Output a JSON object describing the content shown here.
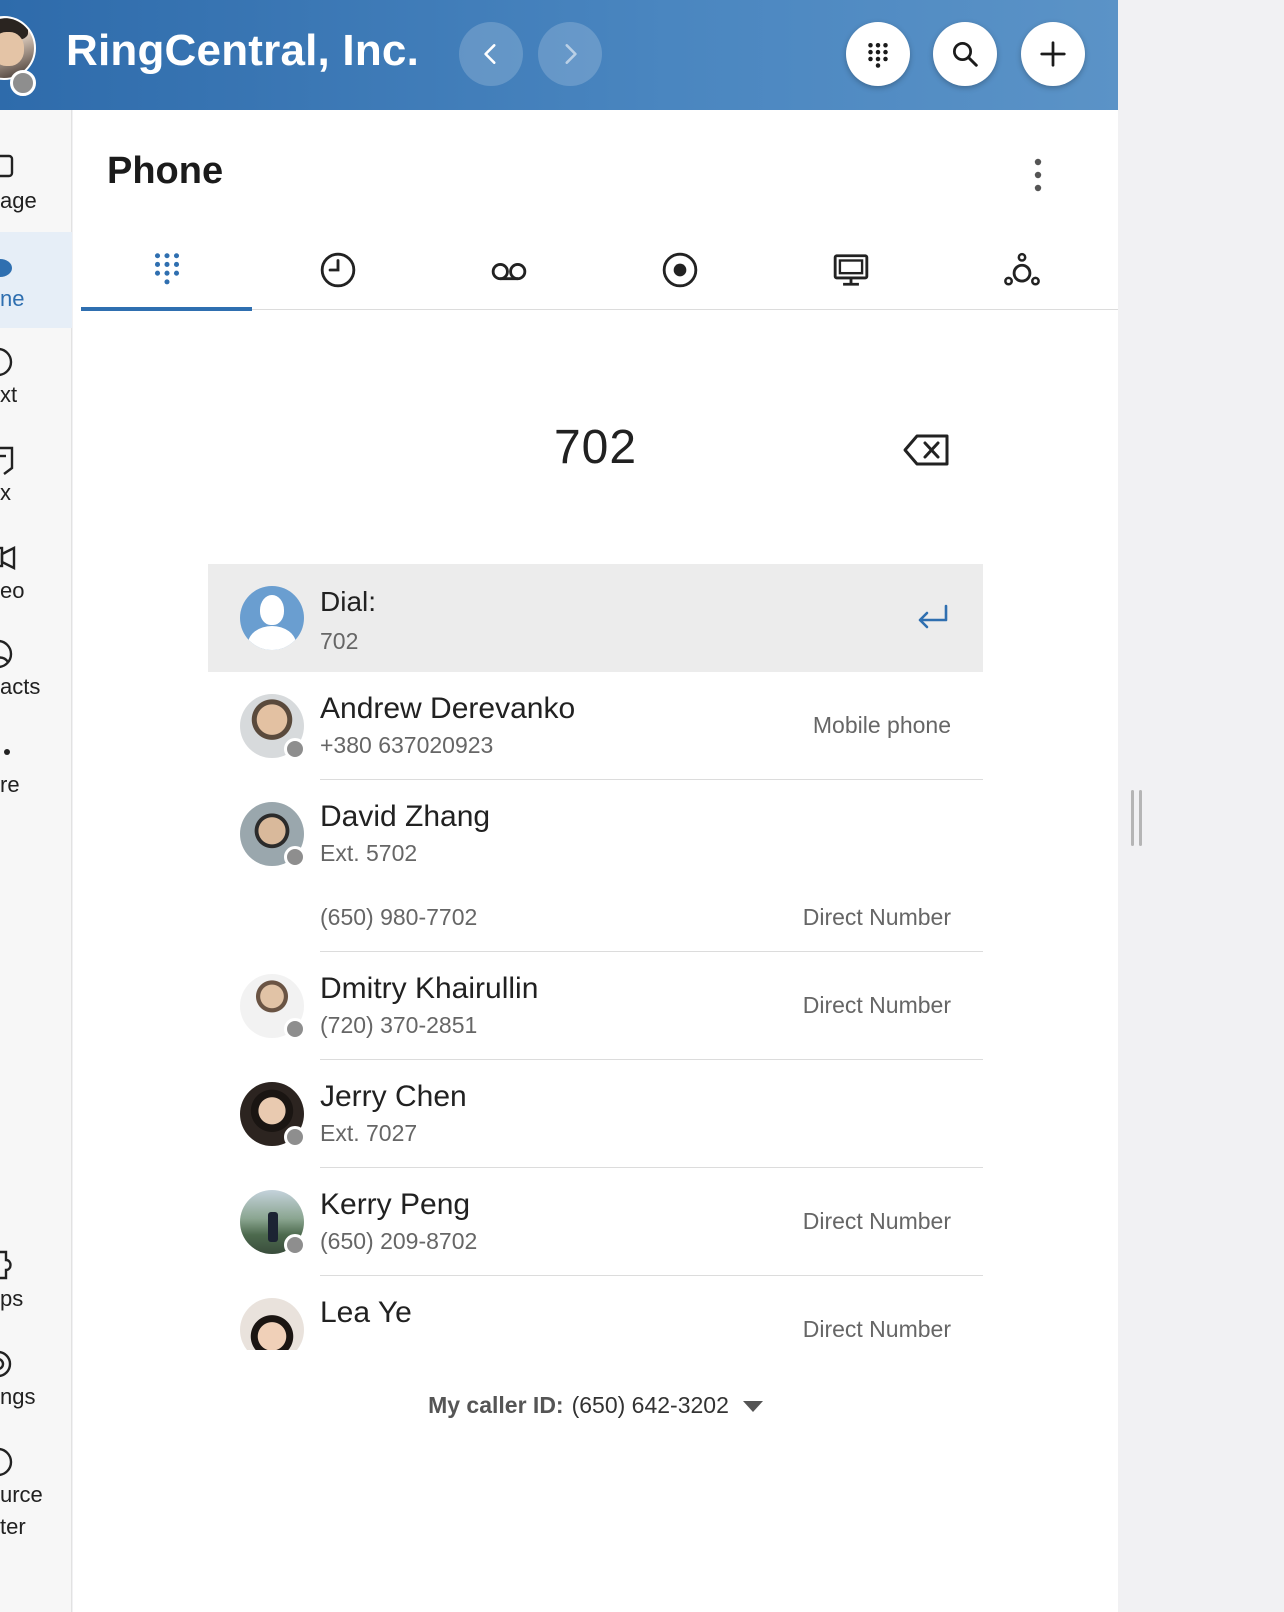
{
  "header": {
    "company": "RingCentral, Inc.",
    "icons": {
      "back": "chevron-left-icon",
      "forward": "chevron-right-icon",
      "dialpad": "dialpad-icon",
      "search": "search-icon",
      "add": "plus-icon"
    },
    "accent": "#2f6fb0"
  },
  "leftnav": {
    "items": [
      {
        "label": "age",
        "icon": "message-icon"
      },
      {
        "label": "ne",
        "icon": "phone-icon",
        "active": true
      },
      {
        "label": "xt",
        "icon": "text-icon"
      },
      {
        "label": "x",
        "icon": "fax-icon"
      },
      {
        "label": "eo",
        "icon": "video-icon"
      },
      {
        "label": "acts",
        "icon": "contacts-icon"
      },
      {
        "label": "re",
        "icon": "more-icon"
      },
      {
        "label": "ps",
        "icon": "apps-icon"
      },
      {
        "label": "ngs",
        "icon": "settings-icon"
      },
      {
        "label": "urce",
        "label2": "ter",
        "icon": "resource-center-icon"
      }
    ]
  },
  "main": {
    "title": "Phone",
    "tabs": [
      {
        "name": "dialpad",
        "icon": "dialpad-icon",
        "active": true
      },
      {
        "name": "call-history",
        "icon": "clock-icon"
      },
      {
        "name": "voicemail",
        "icon": "voicemail-icon"
      },
      {
        "name": "recordings",
        "icon": "record-icon"
      },
      {
        "name": "fax",
        "icon": "monitor-icon"
      },
      {
        "name": "call-queues",
        "icon": "queue-icon"
      }
    ],
    "dial_input": "702",
    "dial_row": {
      "label": "Dial:",
      "number": "702"
    },
    "contacts": [
      {
        "name": "Andrew Derevanko",
        "sub": "+380 637020923",
        "type": "Mobile phone"
      },
      {
        "name": "David Zhang",
        "sub": "Ext. 5702",
        "type": "",
        "extra_sub": "(650) 980-7702",
        "extra_type": "Direct Number"
      },
      {
        "name": "Dmitry Khairullin",
        "sub": "(720) 370-2851",
        "type": "Direct Number"
      },
      {
        "name": "Jerry Chen",
        "sub": "Ext. 7027",
        "type": ""
      },
      {
        "name": "Kerry Peng",
        "sub": "(650) 209-8702",
        "type": "Direct Number"
      },
      {
        "name": "Lea Ye",
        "sub": "",
        "type": "Direct Number"
      }
    ],
    "caller_id": {
      "label": "My caller ID:",
      "value": "(650) 642-3202"
    }
  }
}
